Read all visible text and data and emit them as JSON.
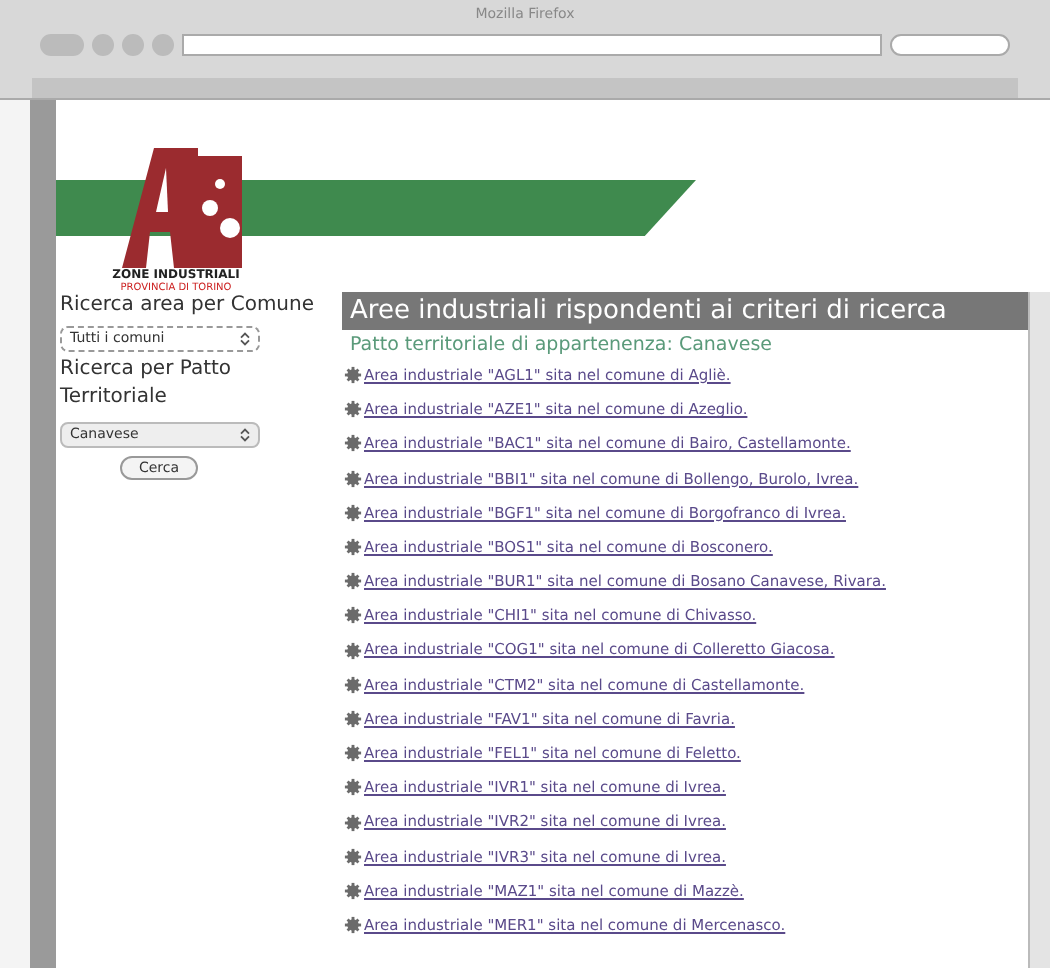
{
  "window": {
    "title": "Mozilla Firefox"
  },
  "logo": {
    "line_1": "ZONE INDUSTRIALI",
    "line_2": "PROVINCIA DI TORINO"
  },
  "sidebar": {
    "comune_label": "Ricerca area per Comune",
    "comune_value": "Tutti i comuni",
    "patto_label": "Ricerca per Patto Territoriale",
    "patto_value": "Canavese",
    "button": "Cerca"
  },
  "main": {
    "heading": "Aree industriali rispondenti ai criteri di ricerca",
    "subheading": "Patto territoriale di appartenenza: Canavese",
    "items": [
      "Area industriale \"AGL1\" sita nel comune di Agliè.",
      "Area industriale \"AZE1\" sita nel comune di Azeglio.",
      "Area industriale \"BAC1\" sita nel comune di Bairo, Castellamonte.",
      "Area industriale \"BBI1\" sita nel comune di Bollengo, Burolo, Ivrea.",
      "Area industriale \"BGF1\" sita nel comune di Borgofranco di Ivrea.",
      "Area industriale \"BOS1\" sita nel comune di Bosconero.",
      "Area industriale \"BUR1\" sita nel comune di Bosano Canavese, Rivara.",
      "Area industriale \"CHI1\" sita nel comune di Chivasso.",
      "Area industriale \"COG1\" sita nel comune di Colleretto Giacosa.",
      "Area industriale \"CTM2\" sita nel comune di Castellamonte.",
      "Area industriale \"FAV1\" sita nel comune di Favria.",
      "Area industriale \"FEL1\" sita nel comune di Feletto.",
      "Area industriale \"IVR1\" sita nel comune di Ivrea.",
      "Area industriale \"IVR2\" sita nel comune di Ivrea.",
      "Area industriale \"IVR3\" sita nel comune di Ivrea.",
      "Area industriale \"MAZ1\" sita nel comune di Mazzè.",
      "Area industriale \"MER1\" sita nel comune di Mercenasco."
    ]
  }
}
